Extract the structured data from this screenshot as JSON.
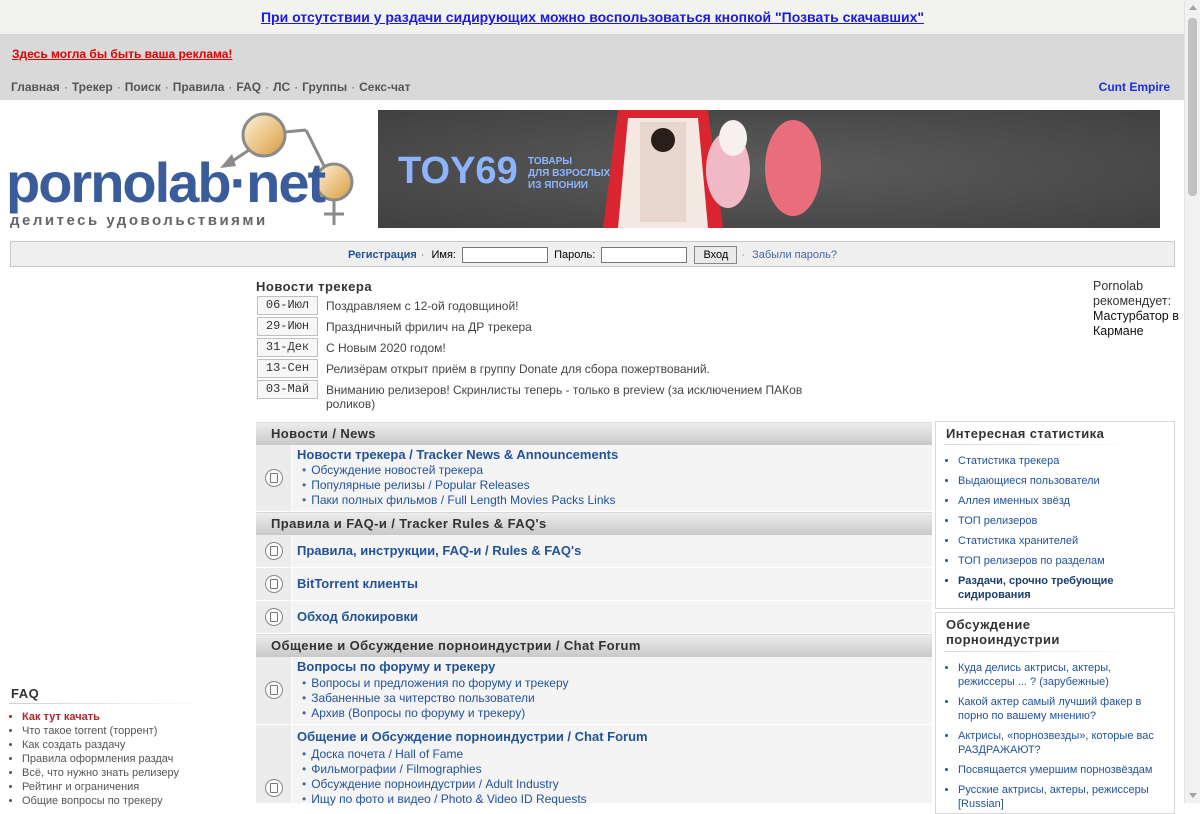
{
  "top_notice": "При отсутствии у раздачи сидирующих можно воспользоваться кнопкой \"Позвать скачавших\"",
  "ad_text": "Здесь могла бы быть ваша реклама!",
  "nav": {
    "items": [
      "Главная",
      "Трекер",
      "Поиск",
      "Правила",
      "FAQ",
      "ЛС",
      "Группы",
      "Секс-чат"
    ],
    "right_link": "Cunt Empire"
  },
  "logo": {
    "name": "pornolab·net",
    "tagline": "делитесь удовольствиями"
  },
  "banner": {
    "brand": "TOY69",
    "tagline_lines": [
      "ТОВАРЫ",
      "ДЛЯ ВЗРОСЛЫХ",
      "ИЗ ЯПОНИИ"
    ]
  },
  "login": {
    "register": "Регистрация",
    "name_label": "Имя:",
    "password_label": "Пароль:",
    "submit": "Вход",
    "forgot": "Забыли пароль?",
    "name_value": "",
    "password_value": ""
  },
  "tracker_news": {
    "title": "Новости трекера",
    "items": [
      {
        "date": "06-Июл",
        "text": "Поздравляем с 12-ой годовщиной!"
      },
      {
        "date": "29-Июн",
        "text": "Праздничный фрилич на ДР трекера"
      },
      {
        "date": "31-Дек",
        "text": "С Новым 2020 годом!"
      },
      {
        "date": "13-Сен",
        "text": "Релизёрам открыт приём в группу Donate для сбора пожертвований."
      },
      {
        "date": "03-Май",
        "text": "Вниманию релизеров! Скринлисты теперь - только в preview (за исключением ПАКов роликов)"
      }
    ]
  },
  "recommend": {
    "label": "Pornolab рекомендует:",
    "link": "Мастурбатор в Кармане"
  },
  "categories": [
    {
      "title": "Новости / News",
      "forums": [
        {
          "title": "Новости трекера / Tracker News & Announcements",
          "subs": [
            "Обсуждение новостей трекера",
            "Популярные релизы / Popular Releases",
            "Паки полных фильмов / Full Length Movies Packs Links"
          ]
        }
      ]
    },
    {
      "title": "Правила и FAQ-и / Tracker Rules & FAQ's",
      "forums": [
        {
          "title": "Правила, инструкции, FAQ-и / Rules & FAQ's",
          "subs": []
        },
        {
          "title": "BitTorrent клиенты",
          "subs": []
        },
        {
          "title": "Обход блокировки",
          "subs": []
        }
      ]
    },
    {
      "title": "Общение и Обсуждение порноиндустрии / Chat Forum",
      "forums": [
        {
          "title": "Вопросы по форуму и трекеру",
          "subs": [
            "Вопросы и предложения по форуму и трекеру",
            "Забаненные за читерство пользователи",
            "Архив (Вопросы по форуму и трекеру)"
          ]
        },
        {
          "title": "Общение и Обсуждение порноиндустрии / Chat Forum",
          "subs": [
            "Доска почета / Hall of Fame",
            "Фильмографии / Filmographies",
            "Обсуждение порноиндустрии / Adult Industry",
            "Ищу по фото и видео / Photo & Video ID Requests"
          ]
        }
      ]
    }
  ],
  "stats_box": {
    "title": "Интересная статистика",
    "items": [
      "Статистика трекера",
      "Выдающиеся пользователи",
      "Аллея именных звёзд",
      "ТОП релизеров",
      "Статистика хранителей",
      "ТОП релизеров по разделам",
      "Раздачи, срочно требующие сидирования"
    ]
  },
  "discussion_box": {
    "title": "Обсуждение порноиндустрии",
    "items": [
      "Куда делись актрисы, актеры, режиссеры ... ? (зарубежные)",
      "Какой актер самый лучший факер в порно по вашему мнению?",
      "Актрисы, «порнозвезды», которые вас РАЗДРАЖАЮТ?",
      "Посвящается умершим порнозвёздам",
      "Русские актрисы, актеры, режиссеры [Russian]"
    ]
  },
  "faq": {
    "title": "FAQ",
    "items": [
      "Как тут качать",
      "Что такое torrent (торрент)",
      "Как создать раздачу",
      "Правила оформления раздач",
      "Всё, что нужно знать релизеру",
      "Рейтинг и ограничения",
      "Общие вопросы по трекеру"
    ]
  }
}
